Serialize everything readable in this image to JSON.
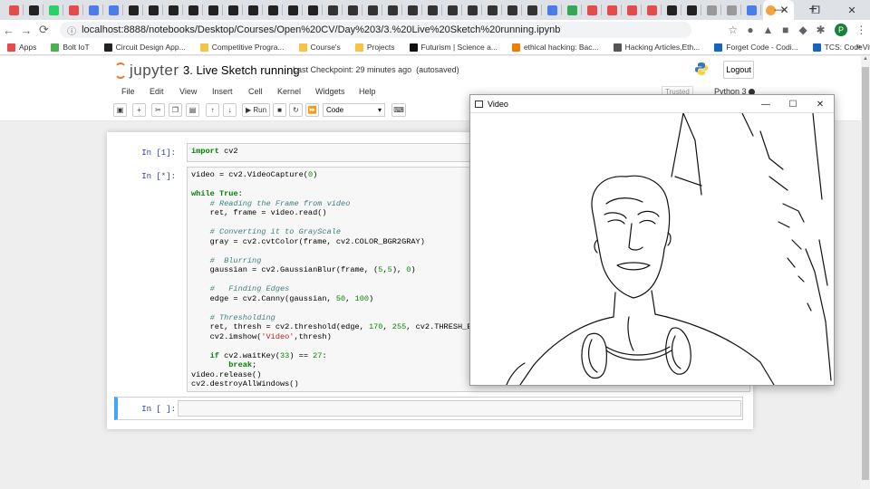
{
  "browser": {
    "url": "localhost:8888/notebooks/Desktop/Courses/Open%20CV/Day%203/3.%20Live%20Sketch%20running.ipynb",
    "tab_favicon_colors": [
      "#e54b4b",
      "#222222",
      "#25d366",
      "#e54b4b",
      "#4b7bec",
      "#4b7bec",
      "#222222",
      "#222222",
      "#222222",
      "#222222",
      "#222222",
      "#222222",
      "#222222",
      "#222222",
      "#222222",
      "#222222",
      "#333333",
      "#333333",
      "#333333",
      "#333333",
      "#333333",
      "#333333",
      "#333333",
      "#333333",
      "#333333",
      "#333333",
      "#333333",
      "#4b7bec",
      "#34a853",
      "#e54b4b",
      "#e54b4b",
      "#e54b4b",
      "#e54b4b",
      "#222222",
      "#222222",
      "#999999",
      "#999999",
      "#4b7bec",
      "#f3a340"
    ],
    "new_tab_symbol": "+",
    "window_controls": [
      "—",
      "❐",
      "✕"
    ]
  },
  "bookmarks": [
    {
      "label": "Apps",
      "color": "#e54b4b"
    },
    {
      "label": "Bolt IoT",
      "color": "#4caf50"
    },
    {
      "label": "Circuit Design App...",
      "color": "#222222"
    },
    {
      "label": "Competitive Progra...",
      "color": "#f6c343"
    },
    {
      "label": "Course's",
      "color": "#f6c343"
    },
    {
      "label": "Projects",
      "color": "#f6c343"
    },
    {
      "label": "Futurism | Science a...",
      "color": "#111111"
    },
    {
      "label": "ethical hacking: Bac...",
      "color": "#f57c00"
    },
    {
      "label": "Hacking Articles,Eth...",
      "color": "#555555"
    },
    {
      "label": "Forget Code - Codi...",
      "color": "#1565c0"
    },
    {
      "label": "TCS: CodeVita - Ho...",
      "color": "#1565c0"
    }
  ],
  "jupyter": {
    "logo_text": "jupyter",
    "notebook_title": "3. Live Sketch running",
    "checkpoint": "Last Checkpoint: 29 minutes ago",
    "autosave": "(autosaved)",
    "logout_label": "Logout",
    "menu": [
      "File",
      "Edit",
      "View",
      "Insert",
      "Cell",
      "Kernel",
      "Widgets",
      "Help"
    ],
    "trusted_label": "Trusted",
    "kernel_name": "Python 3",
    "toolbar": {
      "run_label": "Run",
      "cell_type": "Code"
    },
    "cells": [
      {
        "prompt": "In [1]:"
      },
      {
        "prompt": "In [*]:"
      },
      {
        "prompt": "In [ ]:"
      }
    ]
  },
  "video_window": {
    "title": "Video",
    "controls": [
      "—",
      "☐",
      "✕"
    ]
  },
  "avatar_letter": "P"
}
